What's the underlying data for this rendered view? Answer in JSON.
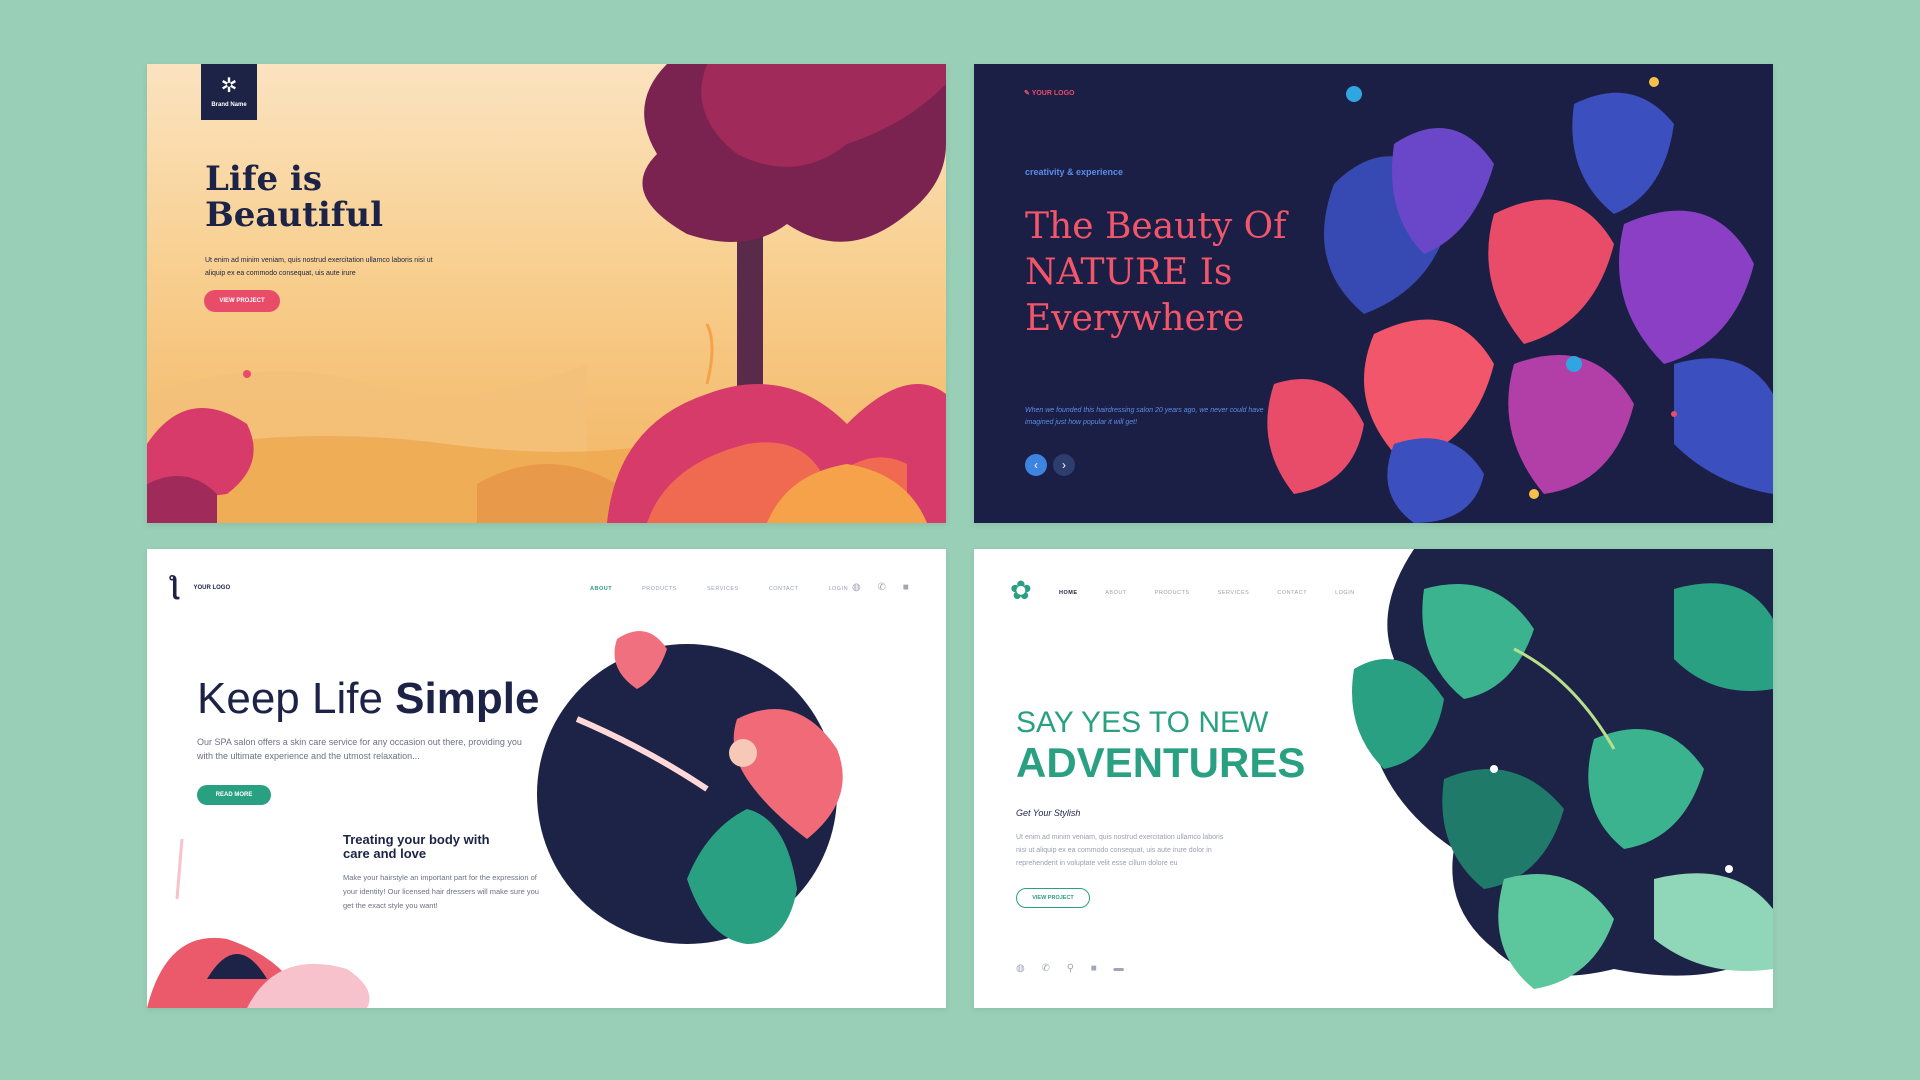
{
  "colors": {
    "background": "#98cfb6",
    "navy": "#1c2346",
    "coral": "#e94c69",
    "teal": "#2aa083",
    "blue": "#5a8de8"
  },
  "card1": {
    "brand_icon": "x-flower-icon",
    "brand_name": "Brand Name",
    "title": "Life is Beautiful",
    "body": "Ut enim ad minim veniam, quis nostrud exercitation ullamco laboris nisi ut aliquip ex ea commodo consequat, uis aute irure",
    "button": "VIEW PROJECT"
  },
  "card2": {
    "logo": "YOUR LOGO",
    "kicker": "creativity & experience",
    "title": "The Beauty Of NATURE Is Everywhere",
    "body": "When we founded this hairdressing salon 20 years ago, we never could have imagined just how popular it will get!",
    "prev_icon": "chevron-left-icon",
    "next_icon": "chevron-right-icon"
  },
  "card3": {
    "logo": "YOUR LOGO",
    "nav": [
      "ABOUT",
      "PRODUCTS",
      "SERVICES",
      "CONTACT",
      "LOGIN"
    ],
    "icons": [
      "globe-icon",
      "phone-icon",
      "video-icon"
    ],
    "title_light": "Keep Life ",
    "title_bold": "Simple",
    "body": "Our SPA salon offers a skin care service for any occasion out there, providing you with the ultimate experience and the utmost relaxation...",
    "button": "READ MORE",
    "sub_title": "Treating your body with care and love",
    "sub_body": "Make your hairstyle an important part for the expression of your identity! Our licensed hair dressers will make sure you get the exact style you want!"
  },
  "card4": {
    "logo_icon": "flower-logo-icon",
    "nav": [
      "HOME",
      "ABOUT",
      "PRODUCTS",
      "SERVICES",
      "CONTACT",
      "LOGIN"
    ],
    "title_small": "SAY YES TO NEW",
    "title_big": "ADVENTURES",
    "tagline": "Get Your Stylish",
    "body": "Ut enim ad minim veniam, quis nostrud exercitation ullamco laboris nisi ut aliquip ex ea commodo consequat, uis aute irure dolor in reprehenderit in voluptate velit esse cillum dolore eu",
    "button": "VIEW PROJECT",
    "icons": [
      "globe-icon",
      "phone-icon",
      "pin-icon",
      "video-icon",
      "chat-icon"
    ]
  }
}
